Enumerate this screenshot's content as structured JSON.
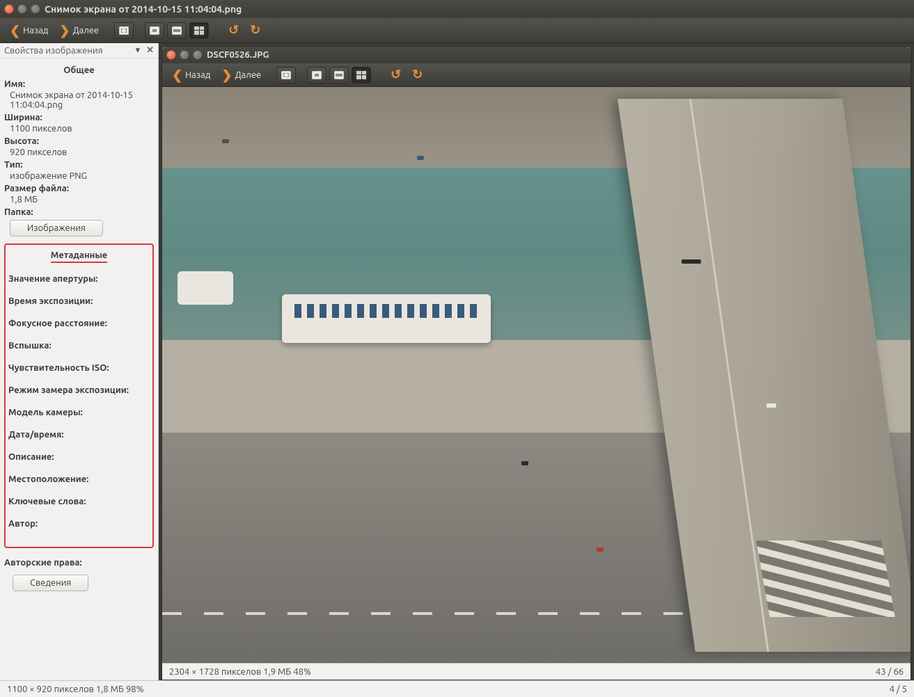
{
  "outer": {
    "title": "Снимок экрана от 2014-10-15 11:04:04.png",
    "nav": {
      "back": "Назад",
      "forward": "Далее"
    },
    "status": {
      "left": "1100 × 920 пикселов  1,8 МБ   98%",
      "right": "4 / 5"
    }
  },
  "sidebar": {
    "header": "Свойства изображения",
    "collapse_glyph": "▾",
    "close_glyph": "✕",
    "general_title": "Общее",
    "props": {
      "name_label": "Имя:",
      "name_value": "Снимок экрана от 2014-10-15 11:04:04.png",
      "width_label": "Ширина:",
      "width_value": "1100 пикселов",
      "height_label": "Высота:",
      "height_value": "920 пикселов",
      "type_label": "Тип:",
      "type_value": "изображение PNG",
      "size_label": "Размер файла:",
      "size_value": "1,8 МБ",
      "folder_label": "Папка:",
      "folder_button": "Изображения"
    },
    "metadata_title": "Метаданные",
    "metadata_labels": [
      "Значение апертуры:",
      "Время экспозиции:",
      "Фокусное расстояние:",
      "Вспышка:",
      "Чувствительность ISO:",
      "Режим замера экспозиции:",
      "Модель камеры:",
      "Дата/время:",
      "Описание:",
      "Местоположение:",
      "Ключевые слова:",
      "Автор:"
    ],
    "copyright_label": "Авторские права:",
    "details_button": "Сведения"
  },
  "inner": {
    "title": "DSCF0526.JPG",
    "nav": {
      "back": "Назад",
      "forward": "Далее"
    },
    "status": {
      "left": "2304 × 1728 пикселов  1,9 МБ   48%",
      "right": "43 / 66"
    }
  }
}
